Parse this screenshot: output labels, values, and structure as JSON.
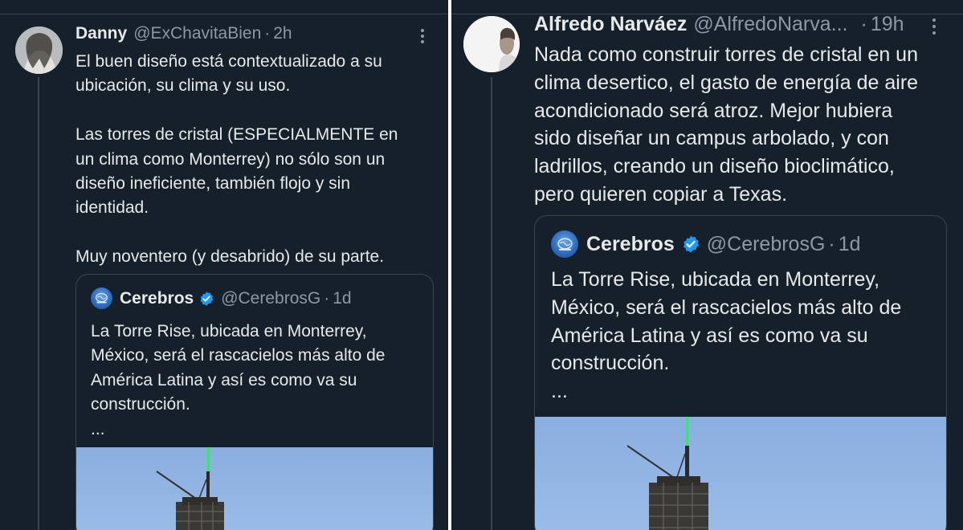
{
  "left_tweet": {
    "author_name": "Danny",
    "author_handle": "@ExChavitaBien",
    "separator": "·",
    "time": "2h",
    "text": "El buen diseño está contextualizado a su\nubicación, su clima y su uso.\n\nLas torres de cristal (ESPECIALMENTE en\nun clima como Monterrey) no sólo son un\ndiseño ineficiente, también flojo y sin\nidentidad.\n\nMuy noventero (y desabrido) de su parte.",
    "quote": {
      "author_name": "Cerebros",
      "author_handle": "@CerebrosG",
      "separator": "·",
      "time": "1d",
      "text": "La Torre Rise, ubicada en Monterrey,\nMéxico, será el rascacielos más alto de\nAmérica Latina y así es como va su\nconstrucción.\n..."
    }
  },
  "right_tweet": {
    "author_name": "Alfredo Narváez",
    "author_handle": "@AlfredoNarva...",
    "separator": "·",
    "time": "19h",
    "text": "Nada como construir torres de cristal en un\nclima desertico, el gasto de energía de aire\nacondicionado será atroz. Mejor hubiera\nsido diseñar un campus arbolado, y con\nladrillos, creando un diseño bioclimático,\npero quieren copiar a Texas.",
    "quote": {
      "author_name": "Cerebros",
      "author_handle": "@CerebrosG",
      "separator": "·",
      "time": "1d",
      "text": "La Torre Rise, ubicada en Monterrey,\nMéxico, será el rascacielos más alto de\nAmérica Latina y así es como va su\nconstrucción.\n..."
    }
  },
  "icons": {
    "more": "more-options-icon",
    "verified": "verified-badge-icon"
  },
  "colors": {
    "background": "#15202b",
    "border": "#38444d",
    "secondary_text": "#8b98a5",
    "primary_text": "#e7e9ea",
    "verified": "#1d9bf0",
    "sky": "#8fb3e3"
  }
}
